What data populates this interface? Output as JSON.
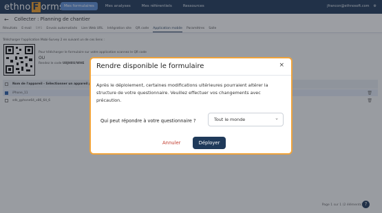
{
  "app": {
    "logo_left": "ethno",
    "logo_box": "F",
    "logo_right": "orms",
    "nav": [
      "Mes formulaires",
      "Mes analyses",
      "Mes référentiels",
      "Ressources"
    ],
    "user_email": "jfrancon@ethnosoft.com",
    "settings_icon": "gear-icon"
  },
  "page": {
    "back_icon": "arrow-left-icon",
    "title": "Collecter : Planning de chantier"
  },
  "tabs": [
    "Résultats",
    "E-mail",
    "SMS",
    "Envois automatisés",
    "Lien Web URL",
    "Intégration site",
    "QR code",
    "Application mobile",
    "Paramètres",
    "Salle"
  ],
  "active_tab": "Application mobile",
  "content": {
    "intro": "Télécharger l'application Mobi-Survey 2 en suivant un de ces liens :",
    "qr_text": "Pour télécharger le formulaire sur votre application scannez le QR code",
    "or": "OU",
    "code_label": "Rendez le code",
    "code_value": "U8JH8U/WHE"
  },
  "table": {
    "header": "Nom de l'appareil - Sélectionner un appareil p",
    "rows": [
      {
        "name": "iPhone_11",
        "checked": true
      },
      {
        "name": "sdk_gphone64_x86_64_6",
        "checked": false
      }
    ]
  },
  "pager": "Page 1 sur 1 (2 éléments)",
  "help_label": "?",
  "modal": {
    "title": "Rendre disponible le formulaire",
    "close": "×",
    "body": "Après le déploiement, certaines modifications ultérieures pourraient altérer la structure de votre questionnaire. Veuillez effectuer vos changements avec précaution.",
    "question": "Qui peut répondre à votre questionnaire ?",
    "select_value": "Tout le monde",
    "cancel": "Annuler",
    "deploy": "Déployer"
  }
}
